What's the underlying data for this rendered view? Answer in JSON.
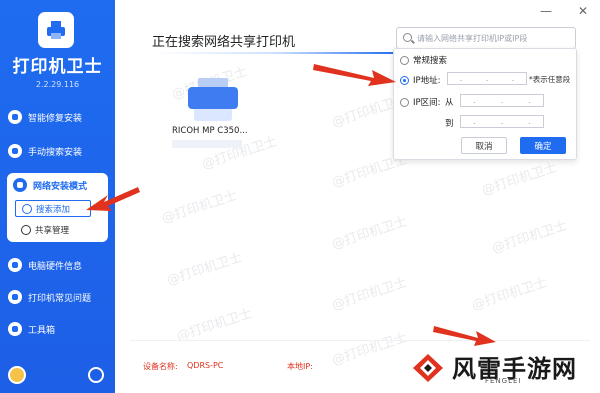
{
  "app": {
    "title": "打印机卫士",
    "version": "2.2.29.116"
  },
  "window_controls": {
    "minimize": "—",
    "close": "✕"
  },
  "sidebar": {
    "items": [
      {
        "label": "智能修复安装",
        "icon": "wrench-icon"
      },
      {
        "label": "手动搜索安装",
        "icon": "search-install-icon"
      },
      {
        "label": "网络安装模式",
        "icon": "network-icon"
      },
      {
        "label": "电脑硬件信息",
        "icon": "computer-icon"
      },
      {
        "label": "打印机常见问题",
        "icon": "printer-help-icon"
      },
      {
        "label": "工具箱",
        "icon": "toolbox-icon"
      }
    ],
    "network_sub": [
      {
        "label": "搜索添加",
        "icon": "search-add-icon"
      },
      {
        "label": "共享管理",
        "icon": "cloud-icon"
      }
    ]
  },
  "main": {
    "title": "正在搜索网络共享打印机",
    "printer_name": "RICOH MP C350...",
    "footer": {
      "device_label": "设备名称:",
      "device_name": "QDRS-PC",
      "ip_label": "本地IP:"
    }
  },
  "search": {
    "placeholder": "请输入网络共享打印机IP或IP段",
    "options": [
      {
        "label": "常规搜索"
      },
      {
        "label": "IP地址:"
      },
      {
        "label": "IP区间:"
      }
    ],
    "ip_from_label": "从",
    "ip_to_label": "到",
    "ip_dots": ".",
    "hint": "*表示任意段",
    "cancel": "取消",
    "confirm": "确定"
  },
  "watermark": "@打印机卫士",
  "brand": {
    "name": "风雷手游网",
    "sub": "FENGLEI"
  },
  "colors": {
    "accent": "#1f6cf0",
    "arrow": "#e0321f"
  }
}
